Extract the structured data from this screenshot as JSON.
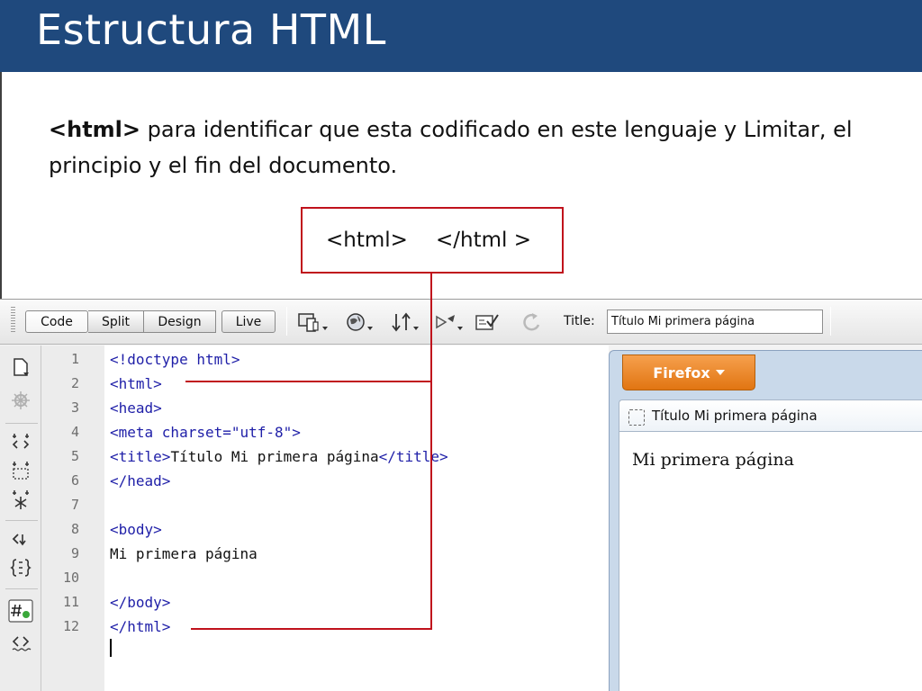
{
  "slide": {
    "title": "Estructura HTML",
    "description_bold": "<html>",
    "description_rest": " para identificar que esta codificado en este lenguaje y Limitar, el principio y el fin del documento.",
    "callout_open": "<html>",
    "callout_close": "</html >"
  },
  "toolbar": {
    "view_buttons": [
      "Code",
      "Split",
      "Design",
      "Live"
    ],
    "title_label": "Title:",
    "title_value": "Título Mi primera página",
    "icons": [
      "multiscreen-icon",
      "preview-globe-icon",
      "file-management-icon",
      "visual-aids-icon",
      "validate-icon",
      "refresh-icon"
    ]
  },
  "editor": {
    "line_numbers": [
      "1",
      "2",
      "3",
      "4",
      "5",
      "6",
      "7",
      "8",
      "9",
      "10",
      "11",
      "12"
    ],
    "lines": [
      {
        "n": "1",
        "parts": [
          {
            "t": "tag",
            "v": "<!doctype html>"
          }
        ]
      },
      {
        "n": "2",
        "parts": [
          {
            "t": "tag",
            "v": "<html>"
          }
        ]
      },
      {
        "n": "3",
        "parts": [
          {
            "t": "tag",
            "v": "<head>"
          }
        ]
      },
      {
        "n": "4",
        "parts": [
          {
            "t": "tag",
            "v": "<meta charset="
          },
          {
            "t": "str",
            "v": "\"utf-8\""
          },
          {
            "t": "tag",
            "v": ">"
          }
        ]
      },
      {
        "n": "5",
        "parts": [
          {
            "t": "tag",
            "v": "<title>"
          },
          {
            "t": "txt",
            "v": "Título Mi primera página"
          },
          {
            "t": "tag",
            "v": "</title>"
          }
        ]
      },
      {
        "n": "6",
        "parts": [
          {
            "t": "tag",
            "v": "</head>"
          }
        ]
      },
      {
        "n": "7",
        "parts": []
      },
      {
        "n": "8",
        "parts": [
          {
            "t": "tag",
            "v": "<body>"
          }
        ]
      },
      {
        "n": "9",
        "parts": [
          {
            "t": "txt",
            "v": "Mi primera página"
          }
        ]
      },
      {
        "n": "10",
        "parts": []
      },
      {
        "n": "11",
        "parts": [
          {
            "t": "tag",
            "v": "</body>"
          }
        ]
      },
      {
        "n": "12",
        "parts": [
          {
            "t": "tag",
            "v": "</html>"
          }
        ]
      }
    ]
  },
  "browser": {
    "menu_button": "Firefox",
    "tab_title": "Título Mi primera página",
    "page_text": "Mi primera página"
  },
  "colors": {
    "title_bar": "#1f497d",
    "annotation_red": "#c0121c",
    "code_tag": "#1f1fa8",
    "firefox_orange": "#e17512"
  }
}
